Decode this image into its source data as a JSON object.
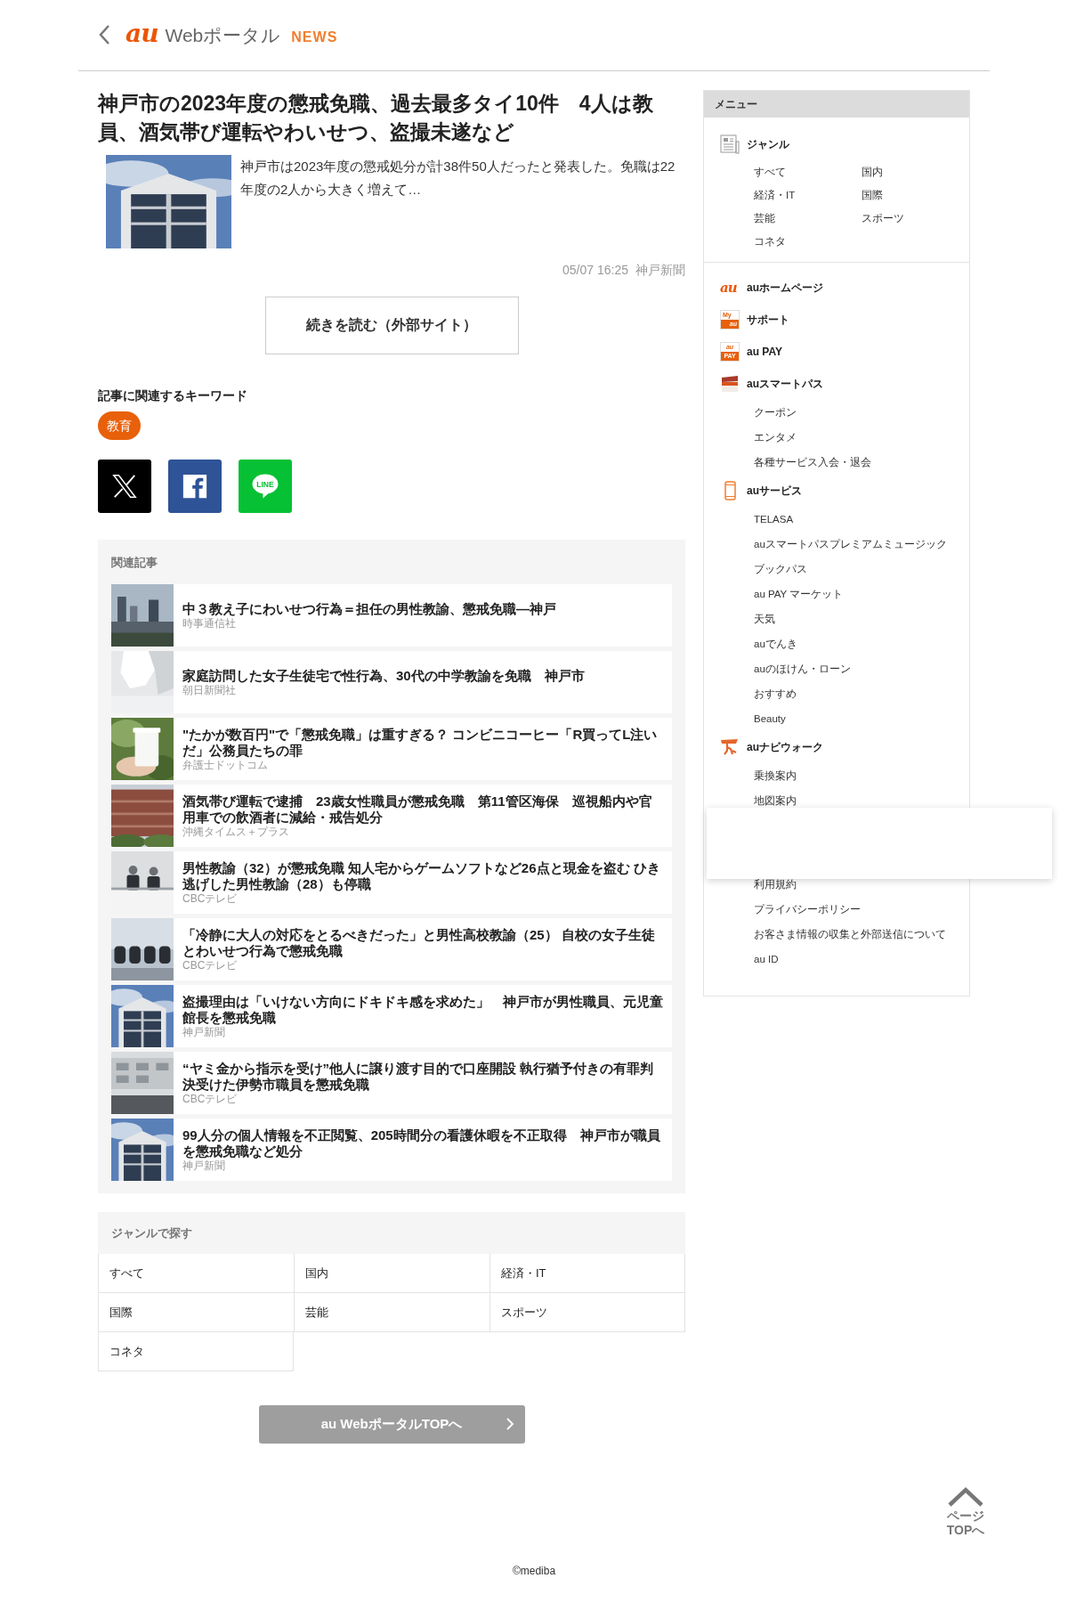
{
  "header": {
    "logo": {
      "mark": "au",
      "name": "Webポータル",
      "section": "NEWS"
    }
  },
  "article": {
    "title": "神戸市の2023年度の懲戒免職、過去最多タイ10件　4人は教員、酒気帯び運転やわいせつ、盗撮未遂など",
    "summary": "神戸市は2023年度の懲戒処分が計38件50人だったと発表した。免職は22年度の2人から大きく増えて…",
    "date": "05/07 16:25",
    "source": "神戸新聞",
    "read_more": "続きを読む（外部サイト）"
  },
  "keywords": {
    "heading": "記事に関連するキーワード",
    "tags": [
      "教育"
    ]
  },
  "share": [
    {
      "kind": "x"
    },
    {
      "kind": "facebook"
    },
    {
      "kind": "line",
      "label": "LINE"
    }
  ],
  "related": {
    "heading": "関連記事",
    "items": [
      {
        "title": "中３教え子にわいせつ行為＝担任の男性教諭、懲戒免職―神戸",
        "source": "時事通信社"
      },
      {
        "title": "家庭訪問した女子生徒宅で性行為、30代の中学教諭を免職　神戸市",
        "source": "朝日新聞社"
      },
      {
        "title": "\"たかが数百円\"で「懲戒免職」は重すぎる？ コンビニコーヒー「R買ってL注いだ」公務員たちの罪",
        "source": "弁護士ドットコム"
      },
      {
        "title": "酒気帯び運転で逮捕　23歳女性職員が懲戒免職　第11管区海保　巡視船内や官用車での飲酒者に減給・戒告処分",
        "source": "沖縄タイムス＋プラス"
      },
      {
        "title": "男性教諭（32）が懲戒免職 知人宅からゲームソフトなど26点と現金を盗む ひき逃げした男性教諭（28）も停職",
        "source": "CBCテレビ"
      },
      {
        "title": "「冷静に大人の対応をとるべきだった」と男性高校教諭（25） 自校の女子生徒とわいせつ行為で懲戒免職",
        "source": "CBCテレビ"
      },
      {
        "title": "盗撮理由は「いけない方向にドキドキ感を求めた」　神戸市が男性職員、元児童館長を懲戒免職",
        "source": "神戸新聞"
      },
      {
        "title": "“ヤミ金から指示を受け”他人に譲り渡す目的で口座開設 執行猶予付きの有罪判決受けた伊勢市職員を懲戒免職",
        "source": "CBCテレビ"
      },
      {
        "title": "99人分の個人情報を不正閲覧、205時間分の看護休暇を不正取得　神戸市が職員を懲戒免職など処分",
        "source": "神戸新聞"
      }
    ]
  },
  "genres": {
    "heading": "ジャンルで探す",
    "items": [
      "すべて",
      "国内",
      "経済・IT",
      "国際",
      "芸能",
      "スポーツ",
      "コネタ"
    ]
  },
  "top_button": "au WebポータルTOPへ",
  "page_top": [
    "ページ",
    "TOPへ"
  ],
  "footer": "©mediba",
  "sidebar": {
    "title": "メニュー",
    "sections": [
      {
        "kind": "genre",
        "label": "ジャンル",
        "items": [
          "すべて",
          "国内",
          "経済・IT",
          "国際",
          "芸能",
          "スポーツ",
          "コネタ"
        ]
      },
      {
        "kind": "au",
        "icon_text": [
          "au"
        ],
        "label": "auホームページ"
      },
      {
        "kind": "myau",
        "icon_text": [
          "My",
          "au"
        ],
        "label": "サポート"
      },
      {
        "kind": "aupay",
        "icon_text": [
          "au",
          "PAY"
        ],
        "label": "au PAY"
      },
      {
        "kind": "pass",
        "label": "auスマートパス",
        "items": [
          "クーポン",
          "エンタメ",
          "各種サービス入会・退会"
        ]
      },
      {
        "kind": "phone",
        "label": "auサービス",
        "items": [
          "TELASA",
          "auスマートパスプレミアムミュージック",
          "ブックパス",
          "au PAY マーケット",
          "天気",
          "auでんき",
          "auのほけん・ローン",
          "おすすめ",
          "Beauty"
        ]
      },
      {
        "kind": "walk",
        "label": "auナビウォーク",
        "items": [
          "乗換案内",
          "地図案内"
        ]
      },
      {
        "kind": "links",
        "items": [
          "利用規約",
          "プライバシーポリシー",
          "お客さま情報の収集と外部送信について",
          "au ID"
        ]
      }
    ],
    "overlay": {
      "kind": "blank-panel"
    }
  }
}
